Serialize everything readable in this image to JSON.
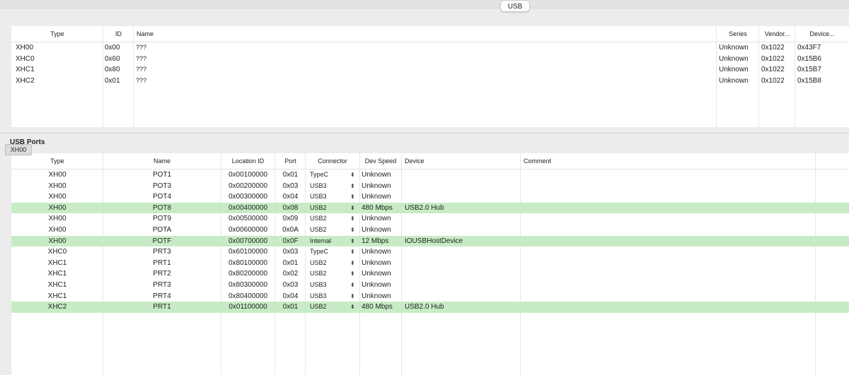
{
  "tabs": {
    "selected": "USB"
  },
  "controllers": {
    "columns": [
      "Type",
      "ID",
      "Name",
      "Series",
      "Vendor...",
      "Device..."
    ],
    "rows": [
      [
        "XH00",
        "0x00",
        "???",
        "Unknown",
        "0x1022",
        "0x43F7"
      ],
      [
        "XHC0",
        "0x60",
        "???",
        "Unknown",
        "0x1022",
        "0x15B6"
      ],
      [
        "XHC1",
        "0x80",
        "???",
        "Unknown",
        "0x1022",
        "0x15B7"
      ],
      [
        "XHC2",
        "0x01",
        "???",
        "Unknown",
        "0x1022",
        "0x15B8"
      ]
    ]
  },
  "ports_section": {
    "title": "USB Ports",
    "tooltip": "XH00"
  },
  "ports": {
    "columns": [
      "Type",
      "Name",
      "Location ID",
      "Port",
      "Connector",
      "Dev Speed",
      "Device",
      "Comment"
    ],
    "selection_color": "#c7ecc5",
    "rows": [
      {
        "type": "XH00",
        "name": "POT1",
        "location": "0x00100000",
        "port": "0x01",
        "connector": "TypeC",
        "speed": "Unknown",
        "device": "",
        "comment": "",
        "selected": false
      },
      {
        "type": "XH00",
        "name": "POT3",
        "location": "0x00200000",
        "port": "0x03",
        "connector": "USB3",
        "speed": "Unknown",
        "device": "",
        "comment": "",
        "selected": false
      },
      {
        "type": "XH00",
        "name": "POT4",
        "location": "0x00300000",
        "port": "0x04",
        "connector": "USB3",
        "speed": "Unknown",
        "device": "",
        "comment": "",
        "selected": false
      },
      {
        "type": "XH00",
        "name": "POT8",
        "location": "0x00400000",
        "port": "0x08",
        "connector": "USB2",
        "speed": "480 Mbps",
        "device": "USB2.0 Hub",
        "comment": "",
        "selected": true
      },
      {
        "type": "XH00",
        "name": "POT9",
        "location": "0x00500000",
        "port": "0x09",
        "connector": "USB2",
        "speed": "Unknown",
        "device": "",
        "comment": "",
        "selected": false
      },
      {
        "type": "XH00",
        "name": "POTA",
        "location": "0x00600000",
        "port": "0x0A",
        "connector": "USB2",
        "speed": "Unknown",
        "device": "",
        "comment": "",
        "selected": false
      },
      {
        "type": "XH00",
        "name": "POTF",
        "location": "0x00700000",
        "port": "0x0F",
        "connector": "Internal",
        "speed": "12 Mbps",
        "device": "IOUSBHostDevice",
        "comment": "",
        "selected": true
      },
      {
        "type": "XHC0",
        "name": "PRT3",
        "location": "0x60100000",
        "port": "0x03",
        "connector": "TypeC",
        "speed": "Unknown",
        "device": "",
        "comment": "",
        "selected": false
      },
      {
        "type": "XHC1",
        "name": "PRT1",
        "location": "0x80100000",
        "port": "0x01",
        "connector": "USB2",
        "speed": "Unknown",
        "device": "",
        "comment": "",
        "selected": false
      },
      {
        "type": "XHC1",
        "name": "PRT2",
        "location": "0x80200000",
        "port": "0x02",
        "connector": "USB2",
        "speed": "Unknown",
        "device": "",
        "comment": "",
        "selected": false
      },
      {
        "type": "XHC1",
        "name": "PRT3",
        "location": "0x80300000",
        "port": "0x03",
        "connector": "USB3",
        "speed": "Unknown",
        "device": "",
        "comment": "",
        "selected": false
      },
      {
        "type": "XHC1",
        "name": "PRT4",
        "location": "0x80400000",
        "port": "0x04",
        "connector": "USB3",
        "speed": "Unknown",
        "device": "",
        "comment": "",
        "selected": false
      },
      {
        "type": "XHC2",
        "name": "PRT1",
        "location": "0x01100000",
        "port": "0x01",
        "connector": "USB2",
        "speed": "480 Mbps",
        "device": "USB2.0 Hub",
        "comment": "",
        "selected": true
      }
    ]
  }
}
